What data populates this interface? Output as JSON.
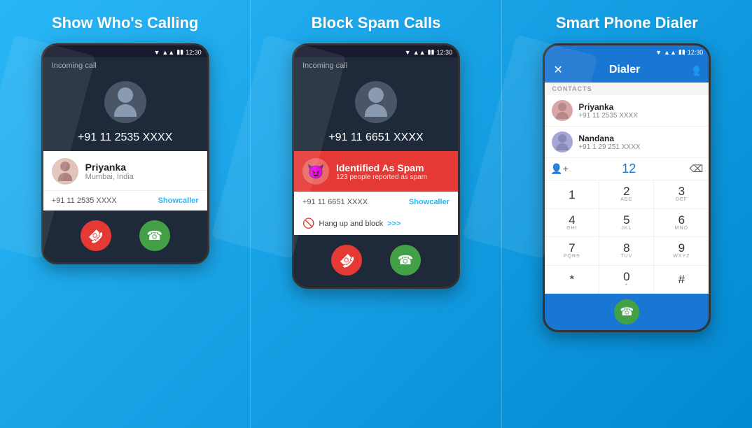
{
  "sections": [
    {
      "id": "show-who-calling",
      "title": "Show Who's Calling",
      "phone": {
        "status_time": "12:30",
        "incoming_label": "Incoming call",
        "caller_number": "+91 11 2535 XXXX",
        "caller_info": {
          "name": "Priyanka",
          "location": "Mumbai, India",
          "number": "+91 11 2535 XXXX",
          "showcaller": "Showcaller"
        }
      }
    },
    {
      "id": "block-spam",
      "title": "Block Spam Calls",
      "phone": {
        "status_time": "12:30",
        "incoming_label": "Incoming call",
        "caller_number": "+91 11 6651 XXXX",
        "spam_info": {
          "title": "Identified As Spam",
          "subtitle": "123 people reported as spam",
          "number": "+91 11 6651 XXXX",
          "showcaller": "Showcaller",
          "hangup": "Hang up and block",
          "hangup_arrows": ">>>"
        }
      }
    },
    {
      "id": "smart-dialer",
      "title": "Smart Phone Dialer",
      "phone": {
        "status_time": "12:30",
        "dialer_title": "Dialer",
        "contacts_label": "CONTACTS",
        "contacts": [
          {
            "name": "Priyanka",
            "number": "+91 11 2535 XXXX"
          },
          {
            "name": "Nandana",
            "number": "+91 1 29 251 XXXX"
          }
        ],
        "input_value": "12",
        "keypad": [
          {
            "main": "1",
            "sub": ""
          },
          {
            "main": "2",
            "sub": "ABC"
          },
          {
            "main": "3",
            "sub": "DEF"
          },
          {
            "main": "4",
            "sub": "GHI"
          },
          {
            "main": "5",
            "sub": "JKL"
          },
          {
            "main": "6",
            "sub": "MNO"
          },
          {
            "main": "7",
            "sub": "PQRS"
          },
          {
            "main": "8",
            "sub": "TUV"
          },
          {
            "main": "9",
            "sub": "WXYZ"
          },
          {
            "main": "*",
            "sub": ""
          },
          {
            "main": "0",
            "sub": "+"
          },
          {
            "main": "#",
            "sub": ""
          }
        ]
      }
    }
  ],
  "icons": {
    "decline": "📞",
    "accept": "📞",
    "spam_devil": "😈",
    "block": "🚫"
  }
}
